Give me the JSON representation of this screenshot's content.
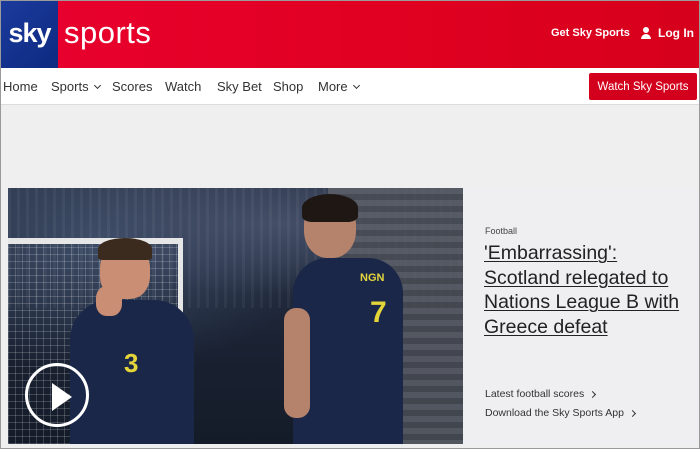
{
  "header": {
    "logo_sky": "sky",
    "logo_sports": "sports",
    "get_sky_sports": "Get Sky Sports",
    "log_in": "Log In"
  },
  "nav": {
    "items": [
      {
        "label": "Home",
        "has_dropdown": false
      },
      {
        "label": "Sports",
        "has_dropdown": true
      },
      {
        "label": "Scores",
        "has_dropdown": false
      },
      {
        "label": "Watch",
        "has_dropdown": false
      },
      {
        "label": "Sky Bet",
        "has_dropdown": false
      },
      {
        "label": "Shop",
        "has_dropdown": false
      },
      {
        "label": "More",
        "has_dropdown": true
      }
    ],
    "watch_button": "Watch Sky Sports"
  },
  "hero": {
    "image": {
      "player1_number": "3",
      "player2_number": "7",
      "player2_name": "NGN"
    },
    "kicker": "Football",
    "headline": "'Embarrassing': Scotland relegated to Nations League B with Greece defeat",
    "links": [
      "Latest football scores",
      "Download the Sky Sports App"
    ]
  },
  "colors": {
    "header_red": "#e10021",
    "sky_blue": "#0d2a80",
    "button_red": "#d3001d",
    "page_bg": "#f0eff0"
  }
}
